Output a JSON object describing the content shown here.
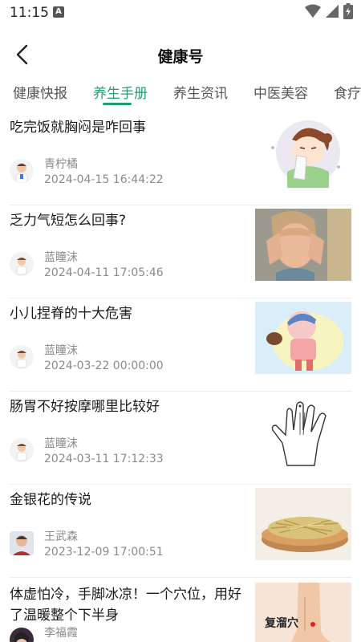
{
  "status": {
    "time": "11:15",
    "a_badge": "A"
  },
  "header": {
    "title": "健康号"
  },
  "tabs": [
    {
      "label": "健康快报"
    },
    {
      "label": "养生手册"
    },
    {
      "label": "养生资讯"
    },
    {
      "label": "中医美容"
    },
    {
      "label": "食疗"
    }
  ],
  "articles": [
    {
      "title": "吃完饭就胸闷是咋回事",
      "author": "青柠橘",
      "date": "2024-04-15 16:44:22"
    },
    {
      "title": "乏力气短怎么回事?",
      "author": "蓝瞳沫",
      "date": "2024-04-11 17:05:46"
    },
    {
      "title": "小儿捏脊的十大危害",
      "author": "蓝瞳沫",
      "date": "2024-03-22 00:00:00"
    },
    {
      "title": "肠胃不好按摩哪里比较好",
      "author": "蓝瞳沫",
      "date": "2024-03-11 17:12:33"
    },
    {
      "title": "金银花的传说",
      "author": "王武森",
      "date": "2023-12-09 17:00:51"
    },
    {
      "title": "体虚怕冷，手脚冰凉！一个穴位，用好了温暖整个下半身",
      "author": "李福霞",
      "date": ""
    }
  ],
  "thumb_labels": {
    "acupoint": "复溜穴"
  },
  "colors": {
    "accent": "#1fa06e",
    "text": "#1a1a1a",
    "meta": "#8a8a8a"
  }
}
